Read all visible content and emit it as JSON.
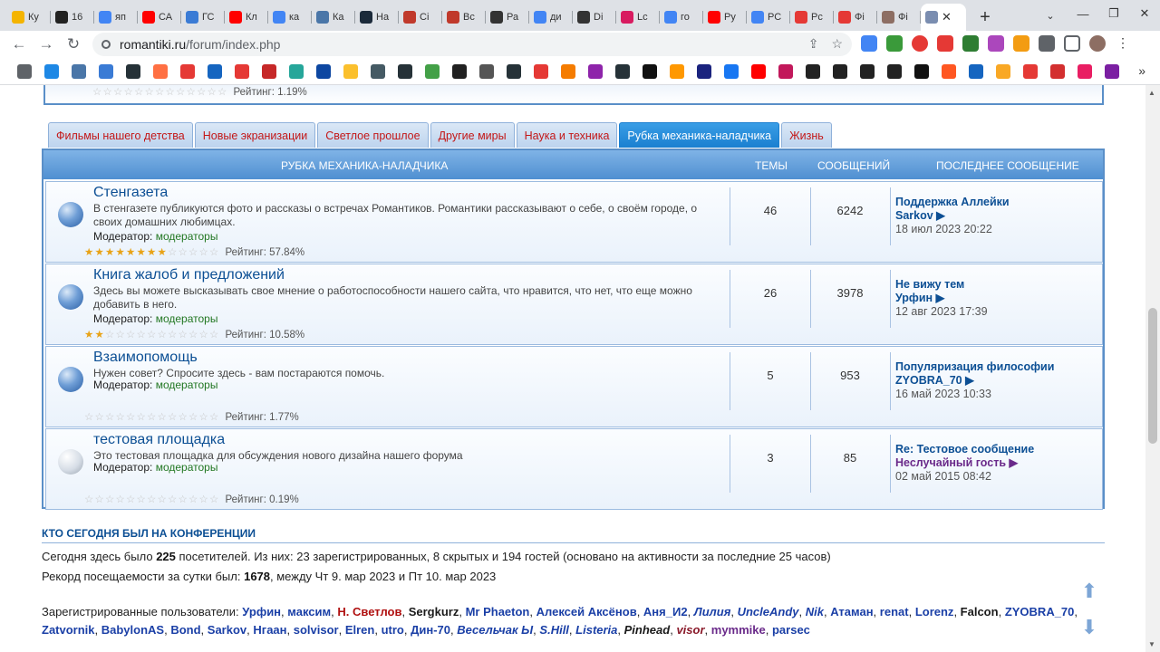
{
  "browser": {
    "tabs": [
      {
        "label": "Ку",
        "color": "#f4b400"
      },
      {
        "label": "16",
        "color": "#222222"
      },
      {
        "label": "яп",
        "color": "#4285f4"
      },
      {
        "label": "СА",
        "color": "#ff0000"
      },
      {
        "label": "ГС",
        "color": "#3a7bd5"
      },
      {
        "label": "Кл",
        "color": "#ff0000"
      },
      {
        "label": "ка",
        "color": "#4285f4"
      },
      {
        "label": "Ка",
        "color": "#4a76a8"
      },
      {
        "label": "На",
        "color": "#1b2a3a"
      },
      {
        "label": "Сі",
        "color": "#c0392b"
      },
      {
        "label": "Вс",
        "color": "#c0392b"
      },
      {
        "label": "Ра",
        "color": "#333333"
      },
      {
        "label": "ди",
        "color": "#4285f4"
      },
      {
        "label": "Di",
        "color": "#333333"
      },
      {
        "label": "Lc",
        "color": "#d81b60"
      },
      {
        "label": "го",
        "color": "#4285f4"
      },
      {
        "label": "Ру",
        "color": "#ff0000"
      },
      {
        "label": "РС",
        "color": "#4285f4"
      },
      {
        "label": "Рс",
        "color": "#e53935"
      },
      {
        "label": "Фі",
        "color": "#e53935"
      },
      {
        "label": "Фі",
        "color": "#8d6e63"
      }
    ],
    "active_tab": {
      "close": "✕"
    },
    "new_tab": "+",
    "url": "romantiki.ru",
    "url_path": "/forum/index.php",
    "window_controls": [
      "—",
      "❐",
      "✕"
    ]
  },
  "header_rating": "Рейтинг: 1.19%",
  "category_tabs": [
    {
      "label": "Фильмы нашего детства",
      "active": false
    },
    {
      "label": "Новые экранизации",
      "active": false
    },
    {
      "label": "Светлое прошлое",
      "active": false
    },
    {
      "label": "Другие миры",
      "active": false
    },
    {
      "label": "Наука и техника",
      "active": false
    },
    {
      "label": "Рубка механика-наладчика",
      "active": true
    },
    {
      "label": "Жизнь",
      "active": false
    }
  ],
  "table_header": {
    "section": "РУБКА МЕХАНИКА-НАЛАДЧИКА",
    "topics": "ТЕМЫ",
    "posts": "СООБЩЕНИЙ",
    "last": "ПОСЛЕДНЕЕ СООБЩЕНИЕ"
  },
  "forums": [
    {
      "title": "Стенгазета",
      "desc": "В стенгазете публикуются фото и рассказы о встречах Романтиков. Романтики рассказывают о себе, о своём городе, о своих домашних любимцах.",
      "mod_label": "Модератор:",
      "mod": "модераторы",
      "rating": "Рейтинг: 57.84%",
      "rating_value": 57.84,
      "topics": "46",
      "posts": "6242",
      "last_title": "Поддержка Аллейки",
      "last_user": "Sarkov ▶",
      "last_date": "18 июл 2023 20:22"
    },
    {
      "title": "Книга жалоб и предложений",
      "desc": "Здесь вы можете высказывать свое мнение о работоспособности нашего сайта, что нравится, что нет, что еще можно добавить в него.",
      "mod_label": "Модератор:",
      "mod": "модераторы",
      "rating": "Рейтинг: 10.58%",
      "rating_value": 10.58,
      "topics": "26",
      "posts": "3978",
      "last_title": "Не вижу тем",
      "last_user": "Урфин ▶",
      "last_date": "12 авг 2023 17:39"
    },
    {
      "title": "Взаимопомощь",
      "desc": "Нужен совет? Спросите здесь - вам постараются помочь.",
      "mod_label": "Модератор:",
      "mod": "модераторы",
      "rating": "Рейтинг: 1.77%",
      "rating_value": 1.77,
      "topics": "5",
      "posts": "953",
      "last_title": "Популяризация философии",
      "last_user": "ZYOBRA_70 ▶",
      "last_date": "16 май 2023 10:33"
    },
    {
      "title": "тестовая площадка",
      "desc": "Это тестовая площадка для обсуждения нового дизайна нашего форума",
      "mod_label": "Модератор:",
      "mod": "модераторы",
      "rating": "Рейтинг: 0.19%",
      "rating_value": 0.19,
      "topics": "3",
      "posts": "85",
      "last_title": "Re: Тестовое сообщение",
      "last_user": "Неслучайный гость ▶",
      "last_date": "02 май 2015 08:42"
    }
  ],
  "online": {
    "heading": "КТО СЕГОДНЯ БЫЛ НА КОНФЕРЕНЦИИ",
    "line1_a": "Сегодня здесь было ",
    "line1_b": "225",
    "line1_c": " посетителей. Из них: 23 зарегистрированных, 8 скрытых и 194 гостей (основано на активности за последние 25 часов)",
    "line2_a": "Рекорд посещаемости за сутки был: ",
    "line2_b": "1678",
    "line2_c": ", между Чт 9. мар 2023 и Пт 10. мар 2023",
    "users_label": "Зарегистрированные пользователи:",
    "users": [
      {
        "name": "Урфин",
        "style": "n"
      },
      {
        "name": "максим",
        "style": "n"
      },
      {
        "name": "Н. Светлов",
        "style": "r"
      },
      {
        "name": "Sergkurz",
        "style": "k"
      },
      {
        "name": "Mr Phaeton",
        "style": "n"
      },
      {
        "name": "Алексей Аксёнов",
        "style": "n"
      },
      {
        "name": "Аня_И2",
        "style": "n"
      },
      {
        "name": "Лилия",
        "style": "i"
      },
      {
        "name": "UncleAndy",
        "style": "i"
      },
      {
        "name": "Nik",
        "style": "i"
      },
      {
        "name": "Атаман",
        "style": "n"
      },
      {
        "name": "renat",
        "style": "n"
      },
      {
        "name": "Lorenz",
        "style": "n"
      },
      {
        "name": "Falcon",
        "style": "k"
      },
      {
        "name": "ZYOBRA_70",
        "style": "n"
      },
      {
        "name": "Zatvornik",
        "style": "n"
      },
      {
        "name": "BabylonAS",
        "style": "n"
      },
      {
        "name": "Bond",
        "style": "n"
      },
      {
        "name": "Sarkov",
        "style": "n"
      },
      {
        "name": "Нгаан",
        "style": "n"
      },
      {
        "name": "solvisor",
        "style": "n"
      },
      {
        "name": "Elren",
        "style": "n"
      },
      {
        "name": "utro",
        "style": "n"
      },
      {
        "name": "Дин-70",
        "style": "n"
      },
      {
        "name": "Весельчак Ы",
        "style": "i"
      },
      {
        "name": "S.Hill",
        "style": "i"
      },
      {
        "name": "Listeria",
        "style": "i"
      },
      {
        "name": "Pinhead",
        "style": "ik"
      },
      {
        "name": "visor",
        "style": "ir"
      },
      {
        "name": "mymmike",
        "style": "p"
      },
      {
        "name": "parsec",
        "style": "n"
      }
    ]
  }
}
